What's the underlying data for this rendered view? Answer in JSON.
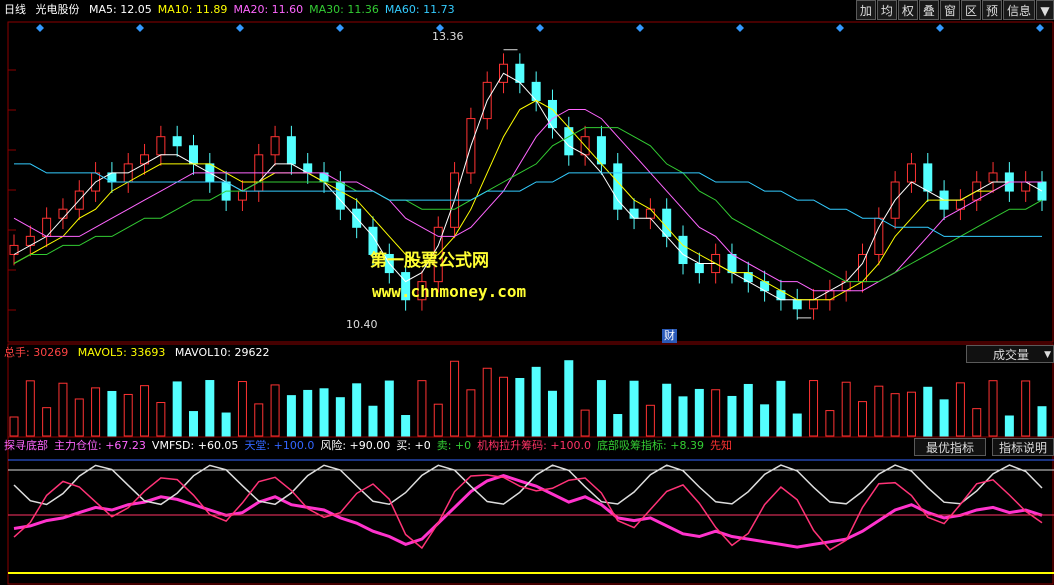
{
  "header": {
    "period": "日线",
    "stock": "光电股份",
    "ma": [
      {
        "label": "MA5: 12.05",
        "color": "#ffffff"
      },
      {
        "label": "MA10: 11.89",
        "color": "#ffff00"
      },
      {
        "label": "MA20: 11.60",
        "color": "#ff66ff"
      },
      {
        "label": "MA30: 11.36",
        "color": "#33cc33"
      },
      {
        "label": "MA60: 11.73",
        "color": "#33ccff"
      }
    ]
  },
  "toolbar": [
    "加",
    "均",
    "权",
    "叠",
    "窗",
    "区",
    "预",
    "信息",
    "▼"
  ],
  "price_chart": {
    "high_label": "13.36",
    "low_label": "10.40",
    "watermark_title": "第一股票公式网",
    "watermark_url": "www.chnmoney.com",
    "marker": "财"
  },
  "volume": {
    "total": {
      "label": "总手: 30269",
      "color": "#ff4444"
    },
    "mavol5": {
      "label": "MAVOL5: 33693",
      "color": "#ffff00"
    },
    "mavol10": {
      "label": "MAVOL10: 29622",
      "color": "#ffffff"
    },
    "selector": "成交量"
  },
  "indicator": {
    "items": [
      {
        "label": "探寻底部",
        "color": "#ff66ff"
      },
      {
        "label": "主力仓位: +67.23",
        "color": "#ff66ff"
      },
      {
        "label": "VMFSD: +60.05",
        "color": "#ffffff"
      },
      {
        "label": "天堂: +100.0",
        "color": "#3366ff"
      },
      {
        "label": "风险: +90.00",
        "color": "#ffffff"
      },
      {
        "label": "买: +0",
        "color": "#ffffff"
      },
      {
        "label": "卖: +0",
        "color": "#33cc33"
      },
      {
        "label": "机构拉升筹码: +100.0",
        "color": "#ff3366"
      },
      {
        "label": "底部吸筹指标: +8.39",
        "color": "#33cc33"
      },
      {
        "label": "先知",
        "color": "#ff3333"
      }
    ],
    "best_button": "最优指标",
    "explain_button": "指标说明"
  },
  "chart_data": {
    "type": "line",
    "title": "光电股份 日线",
    "ylim": [
      10.2,
      13.6
    ],
    "high": 13.36,
    "low": 10.4,
    "close_points": [
      11.2,
      11.3,
      11.5,
      11.6,
      11.8,
      12.0,
      11.9,
      12.1,
      12.2,
      12.4,
      12.3,
      12.1,
      11.9,
      11.7,
      11.8,
      12.2,
      12.4,
      12.1,
      12.0,
      11.9,
      11.6,
      11.4,
      11.1,
      10.9,
      10.6,
      10.8,
      11.4,
      12.0,
      12.6,
      13.0,
      13.2,
      13.0,
      12.8,
      12.5,
      12.2,
      12.4,
      12.1,
      11.6,
      11.5,
      11.6,
      11.3,
      11.0,
      10.9,
      11.1,
      10.9,
      10.8,
      10.7,
      10.6,
      10.5,
      10.6,
      10.7,
      10.8,
      11.1,
      11.5,
      11.9,
      12.1,
      11.8,
      11.6,
      11.7,
      11.9,
      12.0,
      11.8,
      11.9,
      11.7
    ],
    "series": [
      {
        "name": "MA5",
        "color": "#ffffff",
        "values": [
          11.1,
          11.2,
          11.3,
          11.5,
          11.7,
          11.9,
          12.0,
          12.0,
          12.1,
          12.2,
          12.2,
          12.1,
          12.0,
          11.9,
          11.8,
          11.9,
          12.1,
          12.1,
          12.0,
          11.9,
          11.7,
          11.5,
          11.3,
          11.0,
          10.8,
          10.9,
          11.2,
          11.7,
          12.3,
          12.8,
          13.1,
          13.0,
          12.8,
          12.5,
          12.3,
          12.2,
          12.0,
          11.7,
          11.5,
          11.5,
          11.3,
          11.1,
          11.0,
          11.0,
          10.9,
          10.8,
          10.7,
          10.6,
          10.6,
          10.6,
          10.7,
          10.8,
          11.0,
          11.4,
          11.7,
          11.9,
          11.8,
          11.7,
          11.7,
          11.8,
          11.9,
          11.9,
          11.9,
          11.8
        ]
      },
      {
        "name": "MA10",
        "color": "#ffff00",
        "values": [
          11.0,
          11.1,
          11.2,
          11.3,
          11.5,
          11.6,
          11.8,
          11.9,
          12.0,
          12.1,
          12.1,
          12.1,
          12.1,
          12.0,
          11.9,
          11.9,
          12.0,
          12.0,
          12.0,
          11.9,
          11.8,
          11.7,
          11.5,
          11.3,
          11.1,
          11.0,
          11.1,
          11.3,
          11.6,
          12.0,
          12.4,
          12.7,
          12.8,
          12.7,
          12.5,
          12.3,
          12.1,
          11.9,
          11.7,
          11.6,
          11.4,
          11.2,
          11.1,
          11.0,
          10.9,
          10.9,
          10.8,
          10.7,
          10.6,
          10.6,
          10.6,
          10.7,
          10.8,
          11.0,
          11.3,
          11.5,
          11.7,
          11.7,
          11.7,
          11.8,
          11.8,
          11.9,
          11.9,
          11.9
        ]
      },
      {
        "name": "MA20",
        "color": "#ff66ff",
        "values": [
          11.5,
          11.4,
          11.3,
          11.3,
          11.3,
          11.4,
          11.5,
          11.6,
          11.7,
          11.8,
          11.9,
          12.0,
          12.0,
          12.0,
          12.0,
          12.0,
          12.0,
          12.0,
          12.0,
          12.0,
          11.9,
          11.9,
          11.8,
          11.7,
          11.5,
          11.4,
          11.3,
          11.3,
          11.4,
          11.6,
          11.8,
          12.1,
          12.4,
          12.6,
          12.7,
          12.7,
          12.6,
          12.4,
          12.2,
          12.0,
          11.8,
          11.6,
          11.4,
          11.3,
          11.1,
          11.0,
          10.9,
          10.8,
          10.8,
          10.7,
          10.7,
          10.7,
          10.7,
          10.8,
          10.9,
          11.1,
          11.3,
          11.5,
          11.6,
          11.7,
          11.8,
          11.9,
          11.9,
          11.9
        ]
      },
      {
        "name": "MA30",
        "color": "#33cc33",
        "values": [
          11.0,
          11.1,
          11.1,
          11.2,
          11.2,
          11.3,
          11.3,
          11.4,
          11.5,
          11.5,
          11.6,
          11.7,
          11.7,
          11.8,
          11.8,
          11.9,
          11.9,
          11.9,
          11.9,
          11.9,
          11.9,
          11.8,
          11.8,
          11.7,
          11.7,
          11.6,
          11.6,
          11.6,
          11.7,
          11.8,
          11.9,
          12.0,
          12.1,
          12.3,
          12.4,
          12.5,
          12.5,
          12.5,
          12.4,
          12.3,
          12.1,
          12.0,
          11.8,
          11.7,
          11.5,
          11.4,
          11.3,
          11.2,
          11.1,
          11.0,
          10.9,
          10.8,
          10.8,
          10.8,
          10.9,
          11.0,
          11.1,
          11.2,
          11.3,
          11.4,
          11.5,
          11.6,
          11.6,
          11.7
        ]
      },
      {
        "name": "MA60",
        "color": "#33ccff",
        "values": [
          12.1,
          12.1,
          12.0,
          12.0,
          12.0,
          12.0,
          11.9,
          11.9,
          11.9,
          11.9,
          11.9,
          11.9,
          11.9,
          11.9,
          11.8,
          11.8,
          11.8,
          11.8,
          11.8,
          11.8,
          11.8,
          11.8,
          11.8,
          11.7,
          11.7,
          11.7,
          11.7,
          11.7,
          11.7,
          11.8,
          11.8,
          11.8,
          11.9,
          11.9,
          12.0,
          12.0,
          12.0,
          12.0,
          12.0,
          12.0,
          12.0,
          12.0,
          12.0,
          11.9,
          11.9,
          11.9,
          11.8,
          11.8,
          11.7,
          11.7,
          11.6,
          11.6,
          11.5,
          11.5,
          11.4,
          11.4,
          11.4,
          11.3,
          11.3,
          11.3,
          11.3,
          11.3,
          11.3,
          11.3
        ]
      }
    ]
  }
}
